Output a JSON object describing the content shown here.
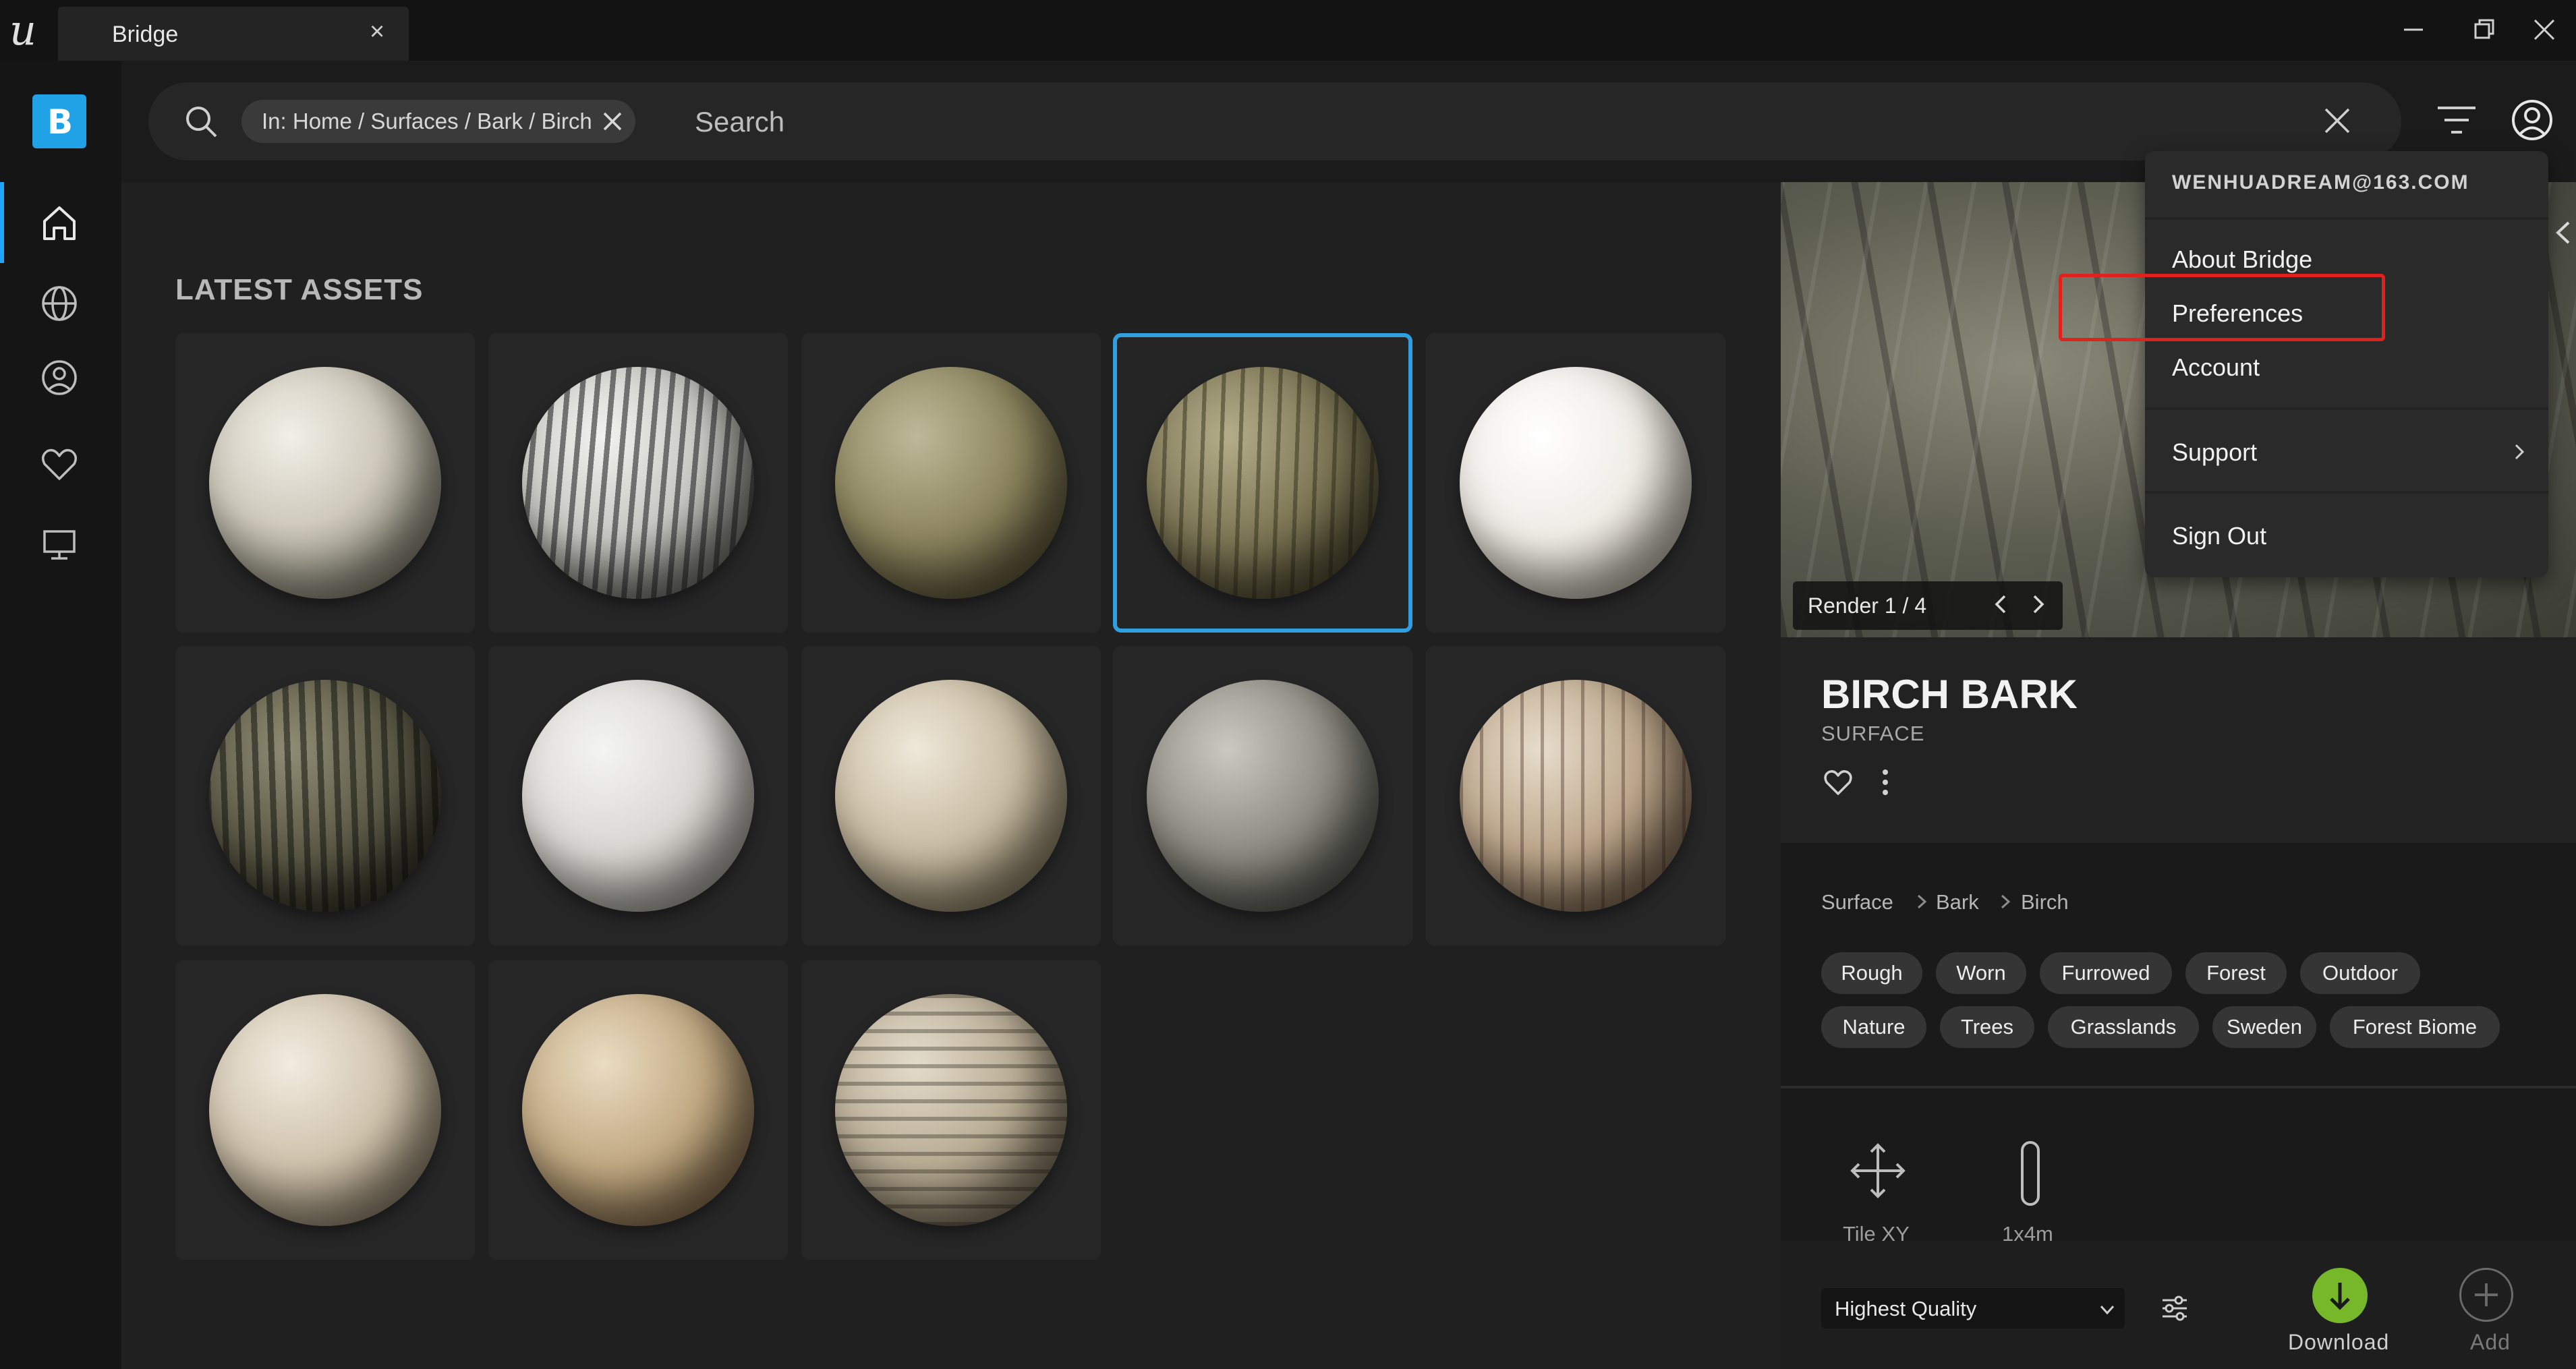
{
  "window": {
    "tab_title": "Bridge"
  },
  "search": {
    "chip_label": "In: Home / Surfaces / Bark / Birch",
    "placeholder": "Search"
  },
  "main": {
    "section_title": "LATEST ASSETS"
  },
  "detail": {
    "render_label": "Render 1 / 4",
    "asset_title": "BIRCH BARK",
    "asset_type": "SURFACE",
    "breadcrumb": [
      "Surface",
      "Bark",
      "Birch"
    ],
    "tags": [
      "Rough",
      "Worn",
      "Furrowed",
      "Forest",
      "Outdoor",
      "Nature",
      "Trees",
      "Grasslands",
      "Sweden",
      "Forest Biome"
    ],
    "properties": [
      {
        "label": "Tile XY",
        "icon": "move-arrows-icon"
      },
      {
        "label": "1x4m",
        "icon": "size-bar-icon"
      }
    ],
    "quality": "Highest Quality",
    "download_label": "Download",
    "add_label": "Add"
  },
  "menu": {
    "email": "WENHUADREAM@163.COM",
    "items": [
      "About Bridge",
      "Preferences",
      "Account",
      "Support",
      "Sign Out"
    ]
  },
  "colors": {
    "accent": "#1ea7ff",
    "selection": "#2f9fe0",
    "download": "#76b82a",
    "highlight": "#e0221f"
  }
}
